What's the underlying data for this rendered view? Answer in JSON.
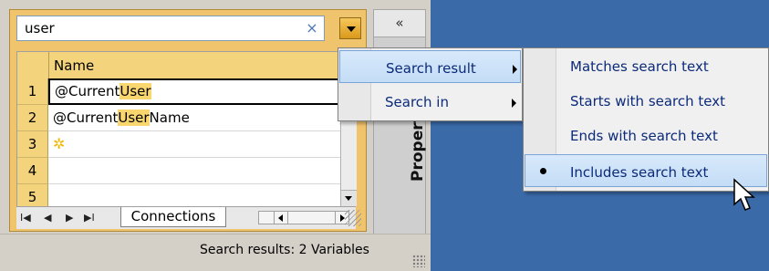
{
  "search": {
    "value": "user",
    "clear_glyph": "×"
  },
  "grid": {
    "header": "Name",
    "highlight_color": "#f9d66e",
    "rows": [
      {
        "num": "1",
        "prefix": "@Current",
        "match": "User",
        "suffix": ""
      },
      {
        "num": "2",
        "prefix": "@Current",
        "match": "User",
        "suffix": "Name"
      },
      {
        "num": "3",
        "new_row_icon": "✲"
      },
      {
        "num": "4"
      },
      {
        "num": "5"
      }
    ]
  },
  "navigation": {
    "first": "I◀",
    "prev": "◀",
    "next": "▶",
    "last": "▶I"
  },
  "tabs": {
    "active": "Connections"
  },
  "side_panel": {
    "collapse_glyph": "«",
    "tab_label": "Properties"
  },
  "status": {
    "text": "Search results: 2 Variables"
  },
  "menu": {
    "items": [
      {
        "label": "Search result"
      },
      {
        "label": "Search in"
      }
    ],
    "submenu": [
      {
        "label": "Matches search text",
        "checked": false
      },
      {
        "label": "Starts with search text",
        "checked": false
      },
      {
        "label": "Ends with search text",
        "checked": false
      },
      {
        "label": "Includes search text",
        "checked": true
      }
    ]
  },
  "colors": {
    "desktop": "#3a6aa8",
    "panel_accent": "#f0c36d",
    "menu_text": "#0b2a79"
  }
}
